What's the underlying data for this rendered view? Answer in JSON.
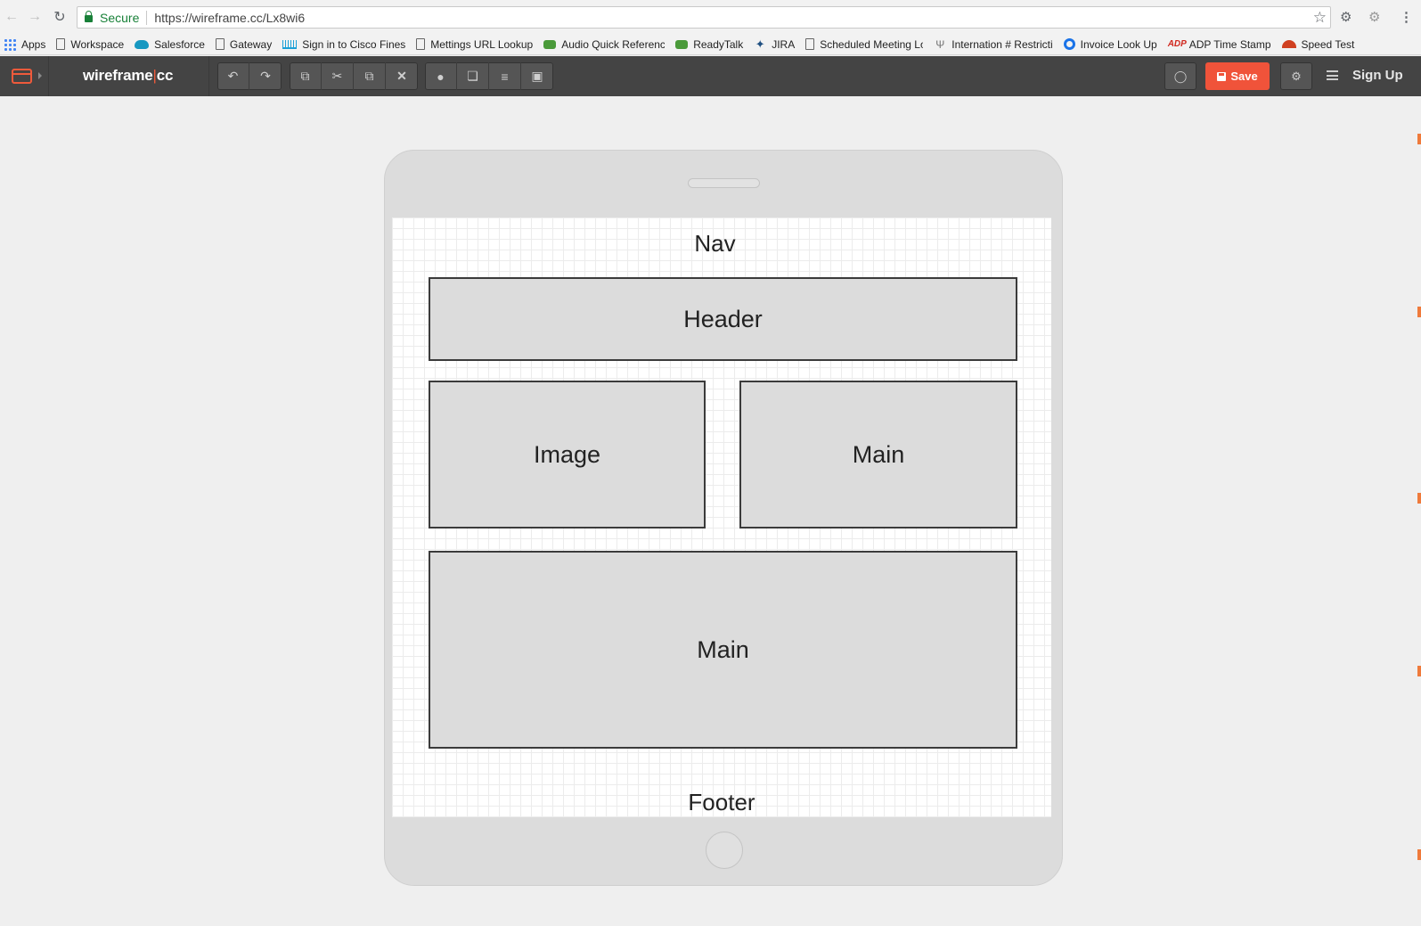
{
  "browser": {
    "secure_label": "Secure",
    "url": "https://wireframe.cc/Lx8wi6",
    "bookmarks": [
      {
        "icon": "apps-icon",
        "label": "Apps"
      },
      {
        "icon": "page-icon",
        "label": "Workspace"
      },
      {
        "icon": "salesforce-cloud-icon",
        "label": "Salesforce"
      },
      {
        "icon": "page-icon",
        "label": "Gateway"
      },
      {
        "icon": "cisco-icon",
        "label": "Sign in to Cisco Finess"
      },
      {
        "icon": "page-icon",
        "label": "Mettings URL Lookup"
      },
      {
        "icon": "chat-bubble-icon",
        "label": "Audio Quick Referenc"
      },
      {
        "icon": "chat-bubble-icon",
        "label": "ReadyTalk"
      },
      {
        "icon": "jira-icon",
        "label": "JIRA"
      },
      {
        "icon": "page-icon",
        "label": "Scheduled Meeting Lo"
      },
      {
        "icon": "antenna-icon",
        "label": "Internation # Restricti"
      },
      {
        "icon": "ring-icon",
        "label": "Invoice Look Up"
      },
      {
        "icon": "adp-icon",
        "label": "ADP Time Stamp"
      },
      {
        "icon": "speedometer-icon",
        "label": "Speed Test"
      }
    ]
  },
  "app": {
    "brand_left": "wireframe",
    "brand_sep": "|",
    "brand_right": "cc",
    "save_label": "Save",
    "signup_label": "Sign Up",
    "accent_color": "#f0533a"
  },
  "wireframe": {
    "nav": "Nav",
    "header": "Header",
    "image": "Image",
    "main_right": "Main",
    "main_bottom": "Main",
    "footer": "Footer"
  }
}
